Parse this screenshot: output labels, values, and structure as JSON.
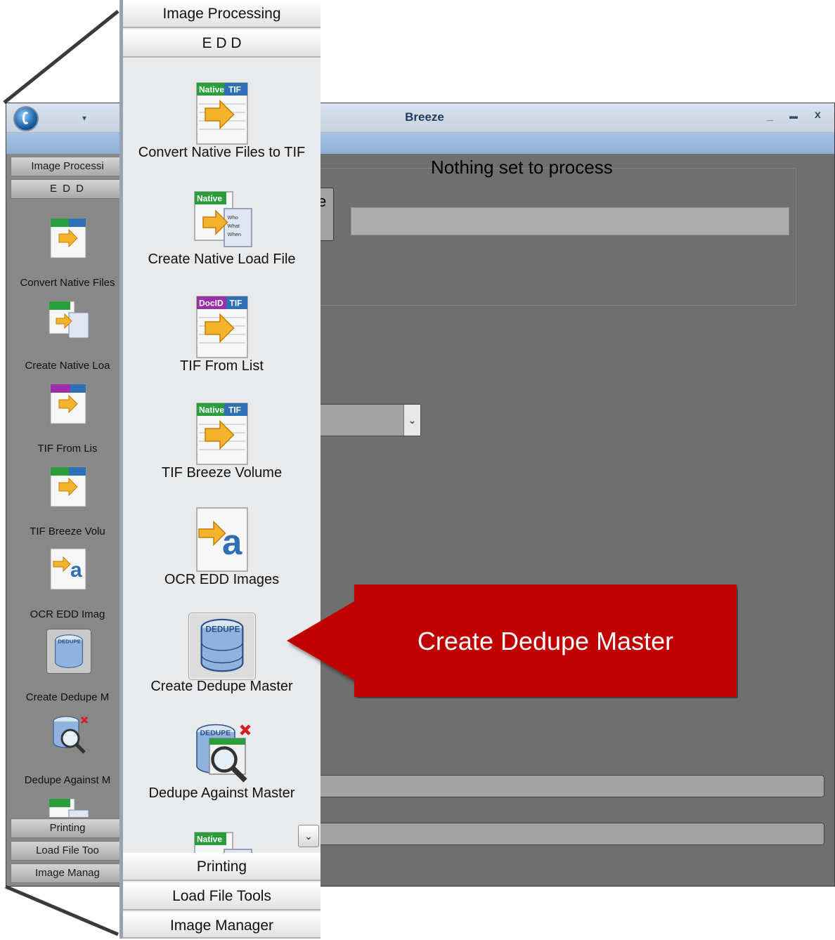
{
  "window": {
    "title": "Breeze",
    "qat_glyph": "▾",
    "minimize_glyph": "_",
    "maximize_glyph": "▬",
    "close_glyph": "x"
  },
  "sidebar": {
    "sections_top": [
      "Image Processing",
      "E D D"
    ],
    "items": [
      {
        "label": "Convert Native Files to TIF",
        "icon": "native-to-tif-icon",
        "badge": "Native",
        "badge2": "TIF"
      },
      {
        "label": "Create Native Load File",
        "icon": "native-load-file-icon",
        "badge": "Native"
      },
      {
        "label": "TIF From List",
        "icon": "docid-tif-icon",
        "badge": "DocID",
        "badge2": "TIF"
      },
      {
        "label": "TIF Breeze Volume",
        "icon": "native-tif-volume-icon",
        "badge": "Native",
        "badge2": "TIF"
      },
      {
        "label": "OCR EDD Images",
        "icon": "ocr-icon",
        "glyph": "a"
      },
      {
        "label": "Create Dedupe Master",
        "icon": "dedupe-database-icon",
        "badge": "DEDUPE",
        "selected": true
      },
      {
        "label": "Dedupe Against Master",
        "icon": "dedupe-search-icon",
        "badge": "DEDUPE"
      },
      {
        "label": "",
        "icon": "native-load-file-icon",
        "badge": "Native"
      }
    ],
    "sections_bottom": [
      "Printing",
      "Load File Tools",
      "Image Manager"
    ],
    "small_labels": {
      "image_processing": "Image Processi",
      "edd": "E D D",
      "items": [
        "Convert Native Files",
        "Create Native Loa",
        "TIF From Lis",
        "TIF Breeze Volu",
        "OCR EDD Imag",
        "Create Dedupe M",
        "Dedupe Against M"
      ],
      "printing": "Printing",
      "load_file": "Load File Too",
      "image_manager": "Image Manag"
    },
    "scroll_glyph": "⌄"
  },
  "main": {
    "status_heading": "Nothing set to process",
    "button_fragment": "e",
    "dropdown_glyph": "⌄"
  },
  "callout": {
    "text": "Create Dedupe Master",
    "color": "#c00000"
  },
  "colors": {
    "app_background": "#6f6f6f",
    "titlebar": "#d0d9e6",
    "ribbon": "#9ab8dd",
    "panel": "#e9eaec"
  }
}
